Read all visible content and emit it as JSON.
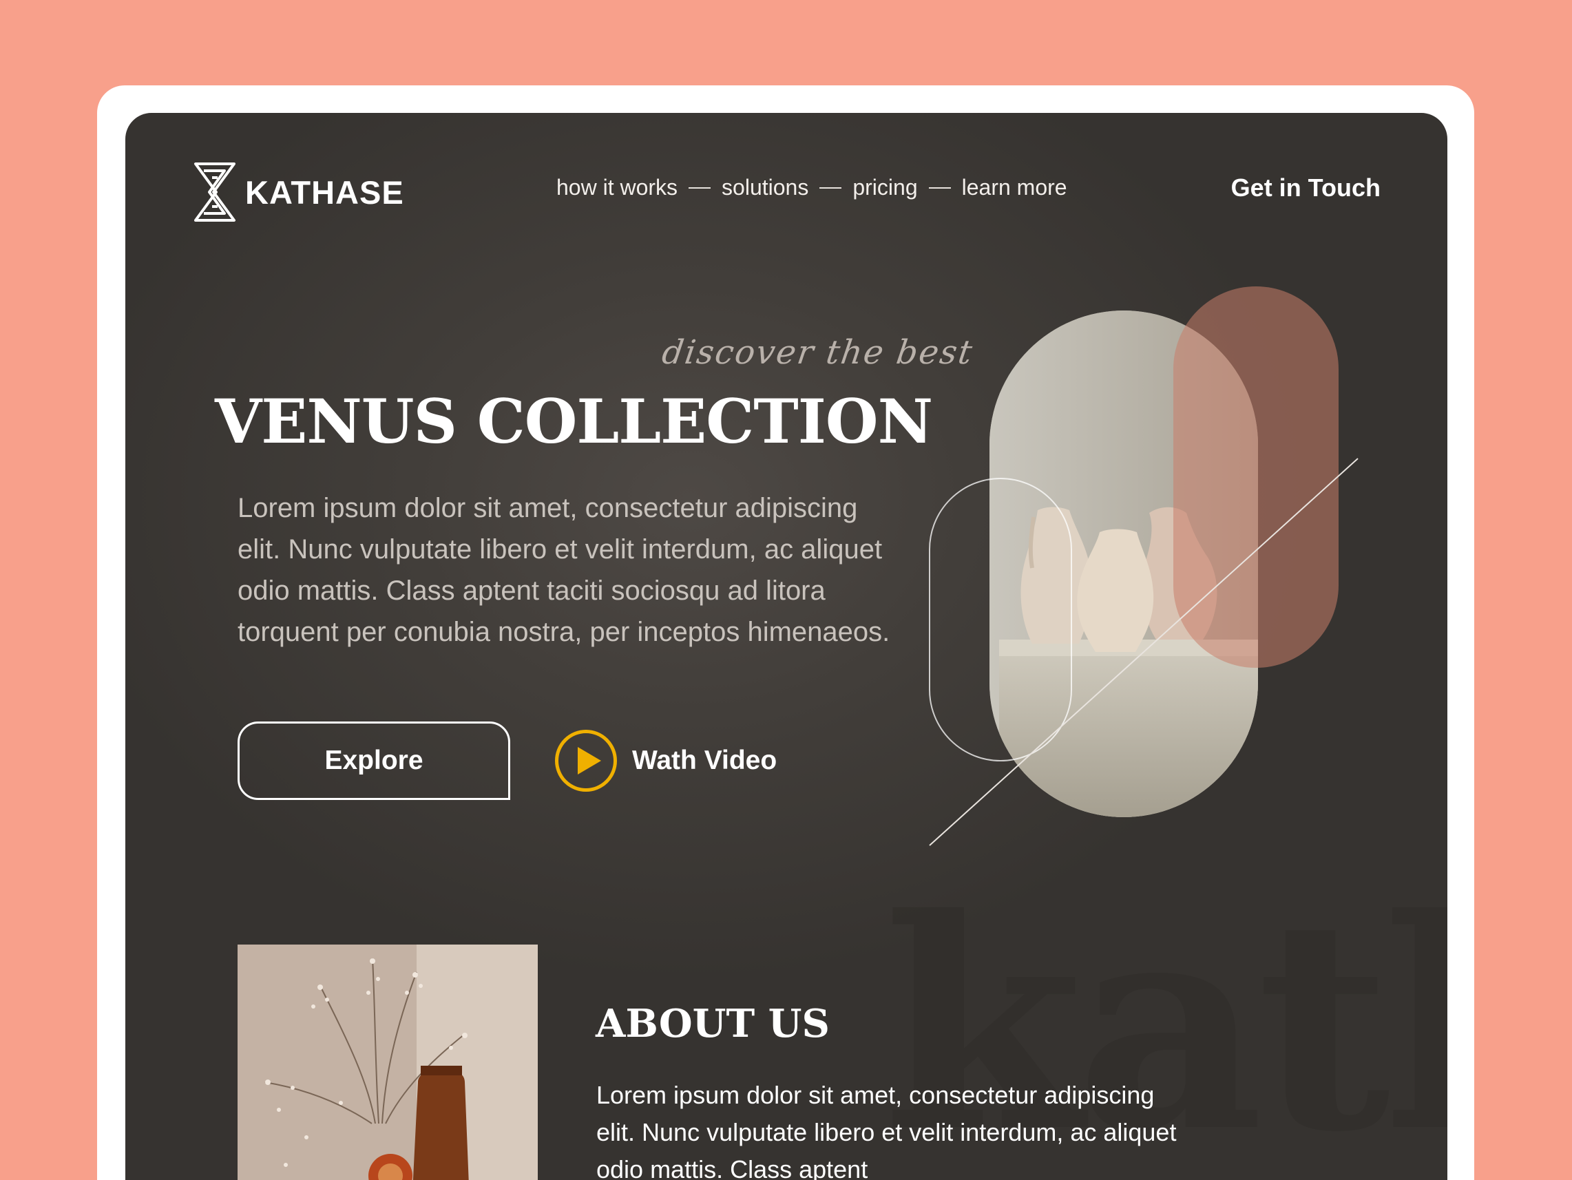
{
  "brand": {
    "name": "KATHASE",
    "logo_icon": "hourglass-stripe-logo"
  },
  "nav": {
    "items": [
      {
        "label": "how it works"
      },
      {
        "label": "solutions"
      },
      {
        "label": "pricing"
      },
      {
        "label": "learn more"
      }
    ],
    "cta": "Get in Touch"
  },
  "hero": {
    "kicker": "discover the best",
    "title": "VENUS COLLECTION",
    "text": "Lorem ipsum dolor sit amet, consectetur adipiscing elit. Nunc vulputate libero et velit interdum, ac aliquet odio mattis. Class aptent taciti sociosqu ad litora torquent per conubia nostra, per inceptos himenaeos.",
    "explore_label": "Explore",
    "video_label": "Wath Video",
    "play_icon": "play-icon"
  },
  "watermark": "kath",
  "about": {
    "title": "ABOUT US",
    "text": "Lorem ipsum dolor sit amet, consectetur adipiscing elit. Nunc vulputate libero et velit interdum, ac aliquet odio mattis. Class aptent"
  },
  "colors": {
    "page_bg": "#f8a08b",
    "screen_bg": "#423e3a",
    "accent": "#f0b000",
    "pink_pill": "#c87e6a"
  }
}
